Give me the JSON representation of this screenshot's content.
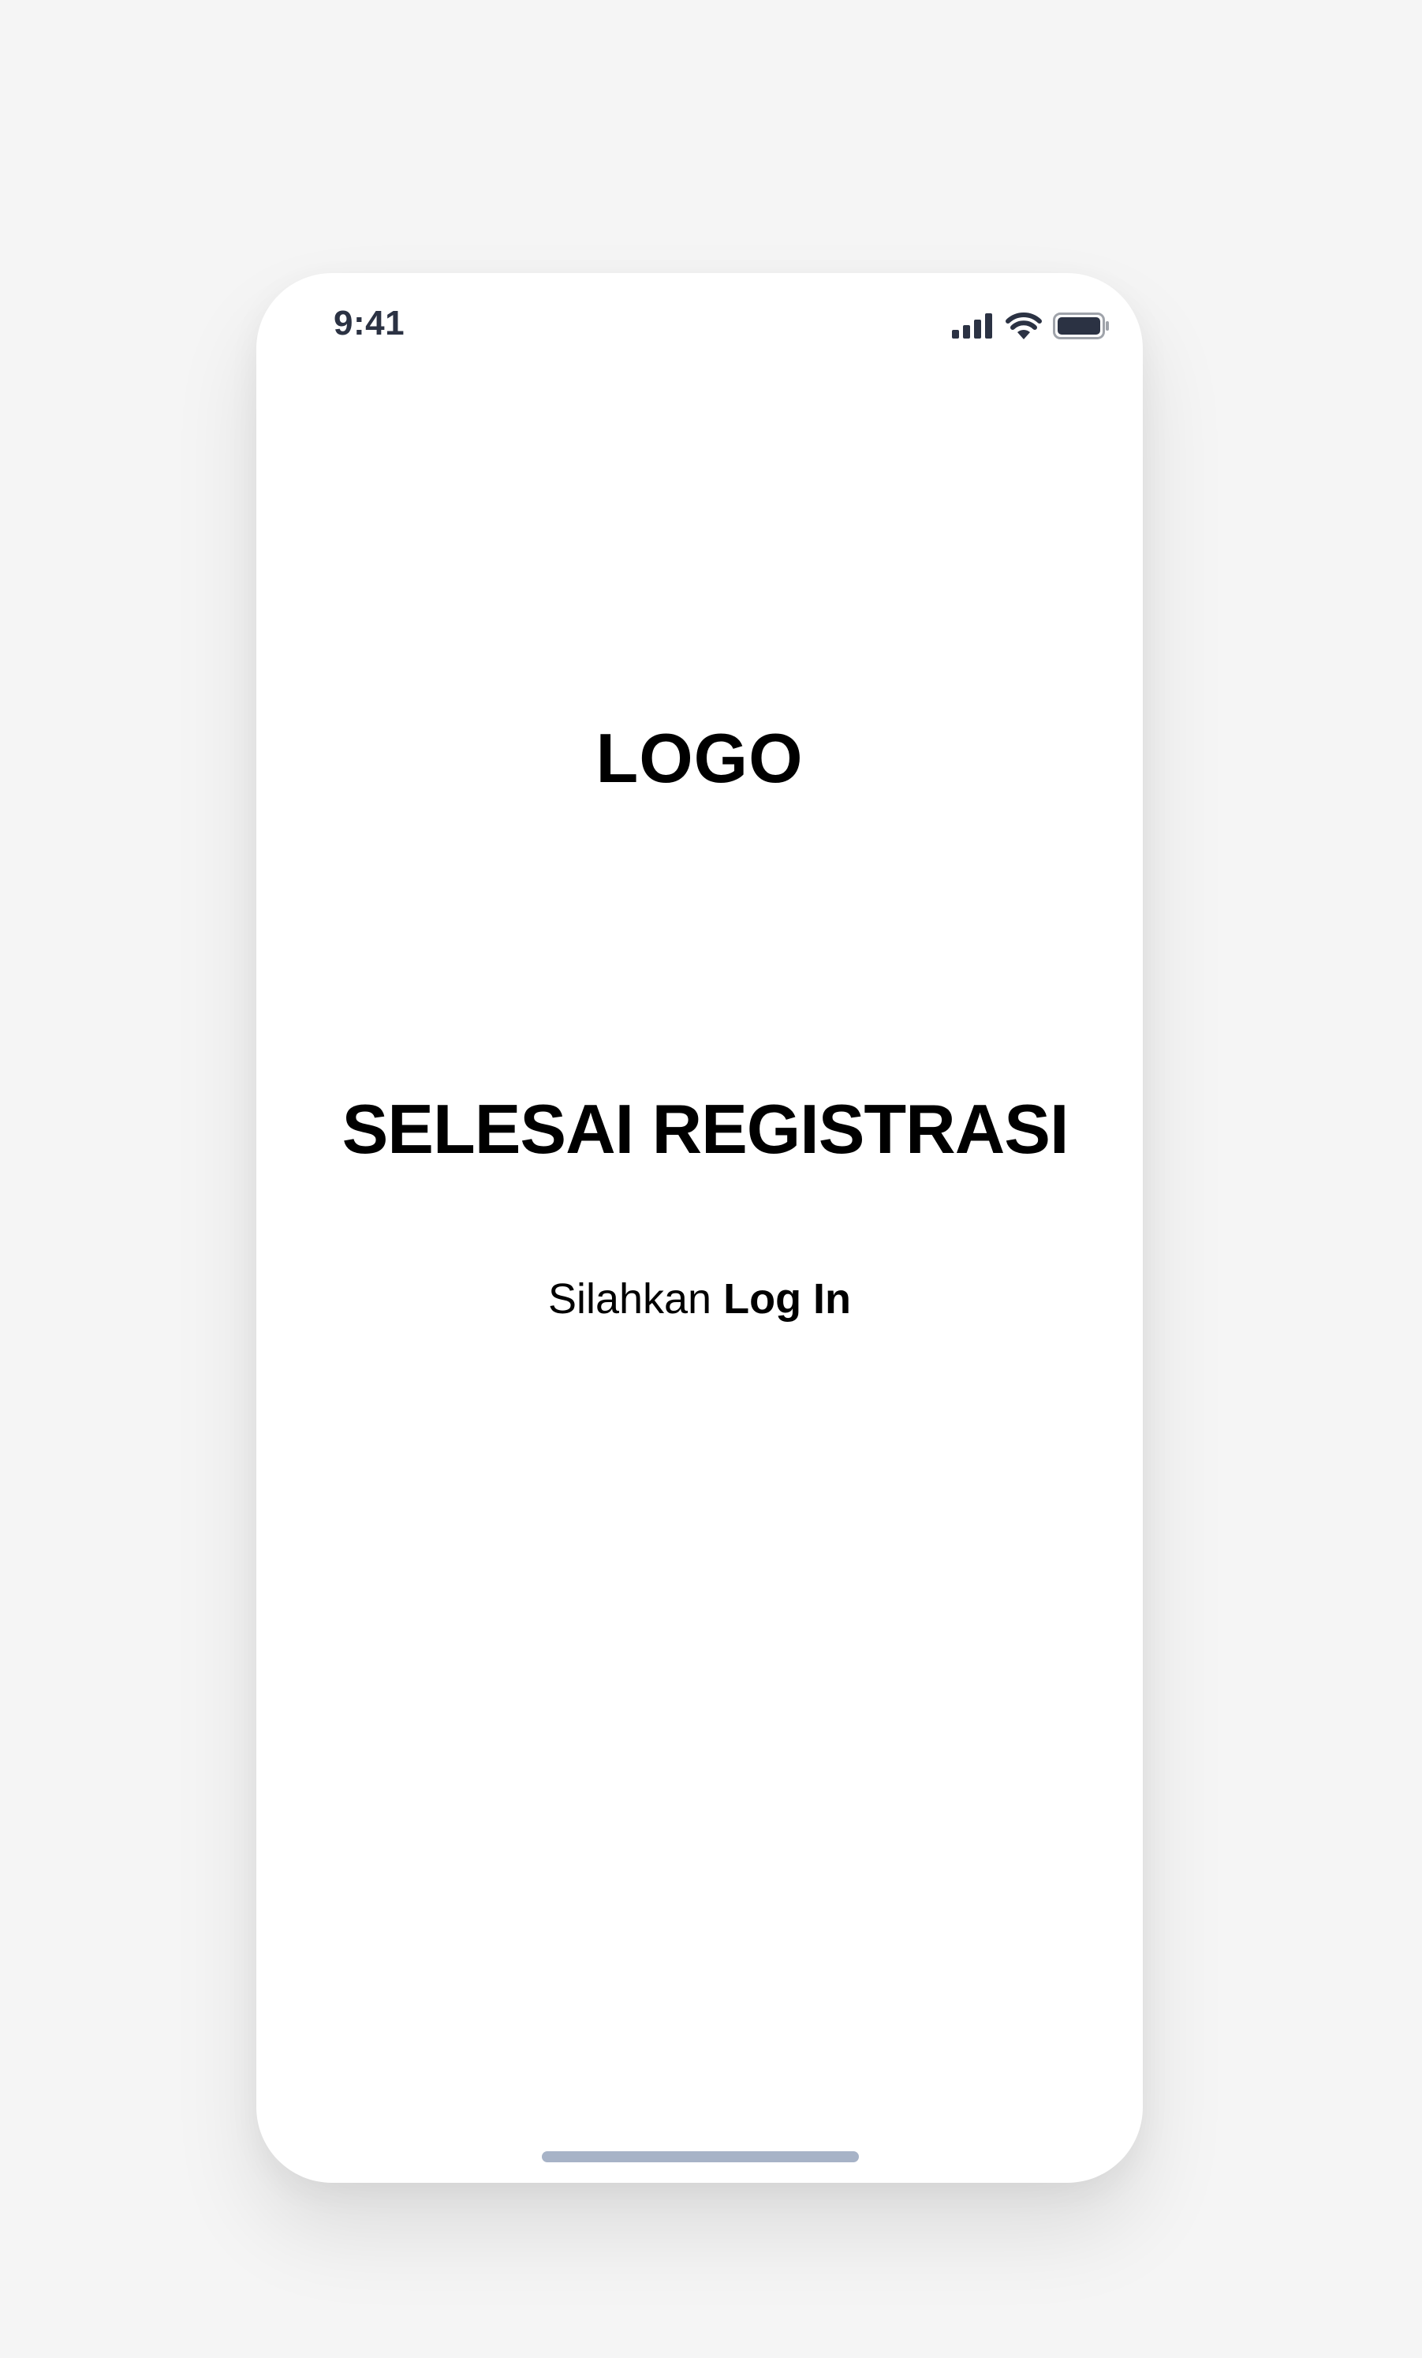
{
  "status_bar": {
    "time": "9:41",
    "icons": [
      "cellular-signal-icon",
      "wifi-icon",
      "battery-icon"
    ]
  },
  "logo": {
    "text": "LOGO"
  },
  "main": {
    "headline": "SELESAI REGISTRASI",
    "login_prefix": "Silahkan",
    "login_link": "Log In"
  },
  "colors": {
    "background": "#f5f5f5",
    "surface": "#ffffff",
    "text": "#000000",
    "status_text": "#2b3243",
    "home_indicator": "#a7b3c7"
  }
}
